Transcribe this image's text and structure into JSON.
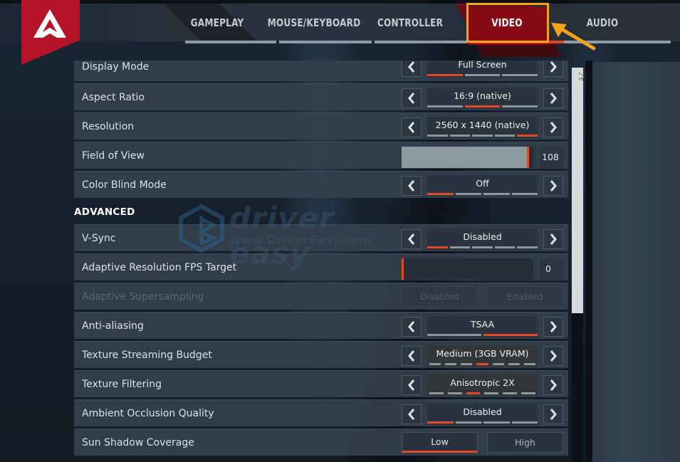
{
  "header": {
    "logo": "apex-legends-logo",
    "tabs": [
      {
        "label": "GAMEPLAY",
        "active": false
      },
      {
        "label": "MOUSE/KEYBOARD",
        "active": false
      },
      {
        "label": "CONTROLLER",
        "active": false
      },
      {
        "label": "VIDEO",
        "active": true
      },
      {
        "label": "AUDIO",
        "active": false
      }
    ]
  },
  "annotation": {
    "highlight_color": "#f0a31b",
    "target": "VIDEO"
  },
  "colors": {
    "accent": "#e3492b",
    "tick_inactive": "#8b979d",
    "logo_red": "#b5132a"
  },
  "settings": {
    "display_mode": {
      "label": "Display Mode",
      "value": "Full Screen",
      "ticks": 3,
      "selected_index": 0
    },
    "aspect_ratio": {
      "label": "Aspect Ratio",
      "value": "16:9 (native)",
      "ticks": 3,
      "selected_index": 1
    },
    "resolution": {
      "label": "Resolution",
      "value": "2560 x 1440 (native)",
      "ticks": 5,
      "selected_index": 4
    },
    "field_of_view": {
      "label": "Field of View",
      "value": "108",
      "fill_fraction": 0.97
    },
    "color_blind_mode": {
      "label": "Color Blind Mode",
      "value": "Off",
      "ticks": 4,
      "selected_index": 0
    }
  },
  "advanced": {
    "title": "ADVANCED",
    "vsync": {
      "label": "V-Sync",
      "value": "Disabled",
      "ticks": 5,
      "selected_index": 0
    },
    "adaptive_fps": {
      "label": "Adaptive Resolution FPS Target",
      "value": "0",
      "fill_fraction": 0.0
    },
    "adaptive_supersampling": {
      "label": "Adaptive Supersampling",
      "options": [
        "Disabled",
        "Enabled"
      ],
      "disabled": true
    },
    "anti_aliasing": {
      "label": "Anti-aliasing",
      "value": "TSAA",
      "ticks": 2,
      "selected_index": 1
    },
    "texture_budget": {
      "label": "Texture Streaming Budget",
      "value": "Medium (3GB VRAM)",
      "ticks": 7,
      "selected_index": 3
    },
    "texture_filtering": {
      "label": "Texture Filtering",
      "value": "Anisotropic 2X",
      "ticks": 6,
      "selected_index": 2
    },
    "ambient_occlusion": {
      "label": "Ambient Occlusion Quality",
      "value": "Disabled",
      "ticks": 4,
      "selected_index": 0
    },
    "sun_shadow": {
      "label": "Sun Shadow Coverage",
      "options": [
        "Low",
        "High"
      ],
      "selected": "Low"
    }
  },
  "watermark": {
    "brand": "driver easy",
    "url": "www.DriverEasy.com"
  }
}
